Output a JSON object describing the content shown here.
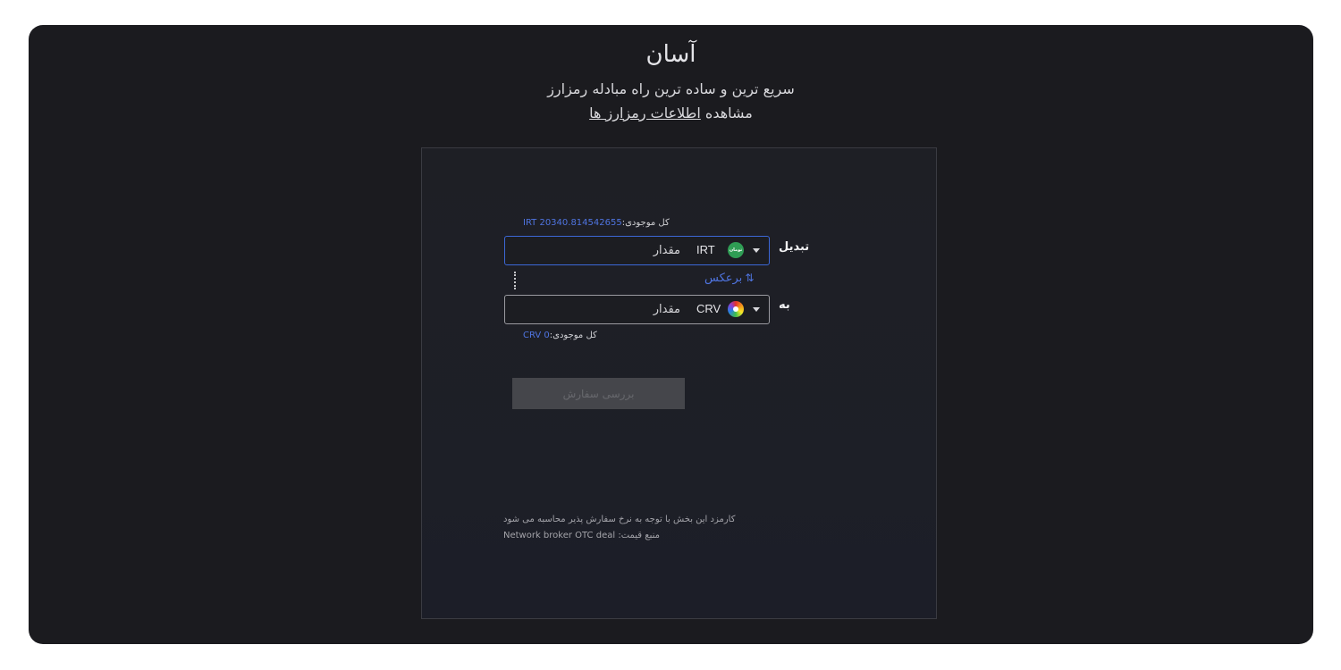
{
  "header": {
    "title": "آسان",
    "subtitle": "سریع ترین و ساده ترین راه مبادله رمزارز",
    "info_prefix": "مشاهده ",
    "info_link": "اطلاعات رمزارز ها"
  },
  "exchange": {
    "from": {
      "label": "تبدیل",
      "balance_label": "کل موجودی:",
      "balance_value": "IRT 20340.814542655",
      "currency": "IRT",
      "icon": "toman-icon",
      "icon_text": "تومان",
      "amount_placeholder": "مقدار"
    },
    "reverse_label": "برعکس",
    "reverse_icon": "⇅",
    "to": {
      "label": "به",
      "balance_label": "کل موجودی:",
      "balance_value": "CRV 0",
      "currency": "CRV",
      "icon": "crv-icon",
      "amount_placeholder": "مقدار"
    },
    "review_button": "بررسی سفارش"
  },
  "notes": {
    "fee": "کارمزد این بخش با توجه به نرخ سفارش پذیر محاسبه می شود",
    "source_label": "منبع قیمت: ",
    "source_value": "Network broker OTC deal"
  },
  "colors": {
    "background": "#1b1b1f",
    "accent": "#4f74e0",
    "active_border": "#3c67d6",
    "disabled_button": "#45464b"
  }
}
